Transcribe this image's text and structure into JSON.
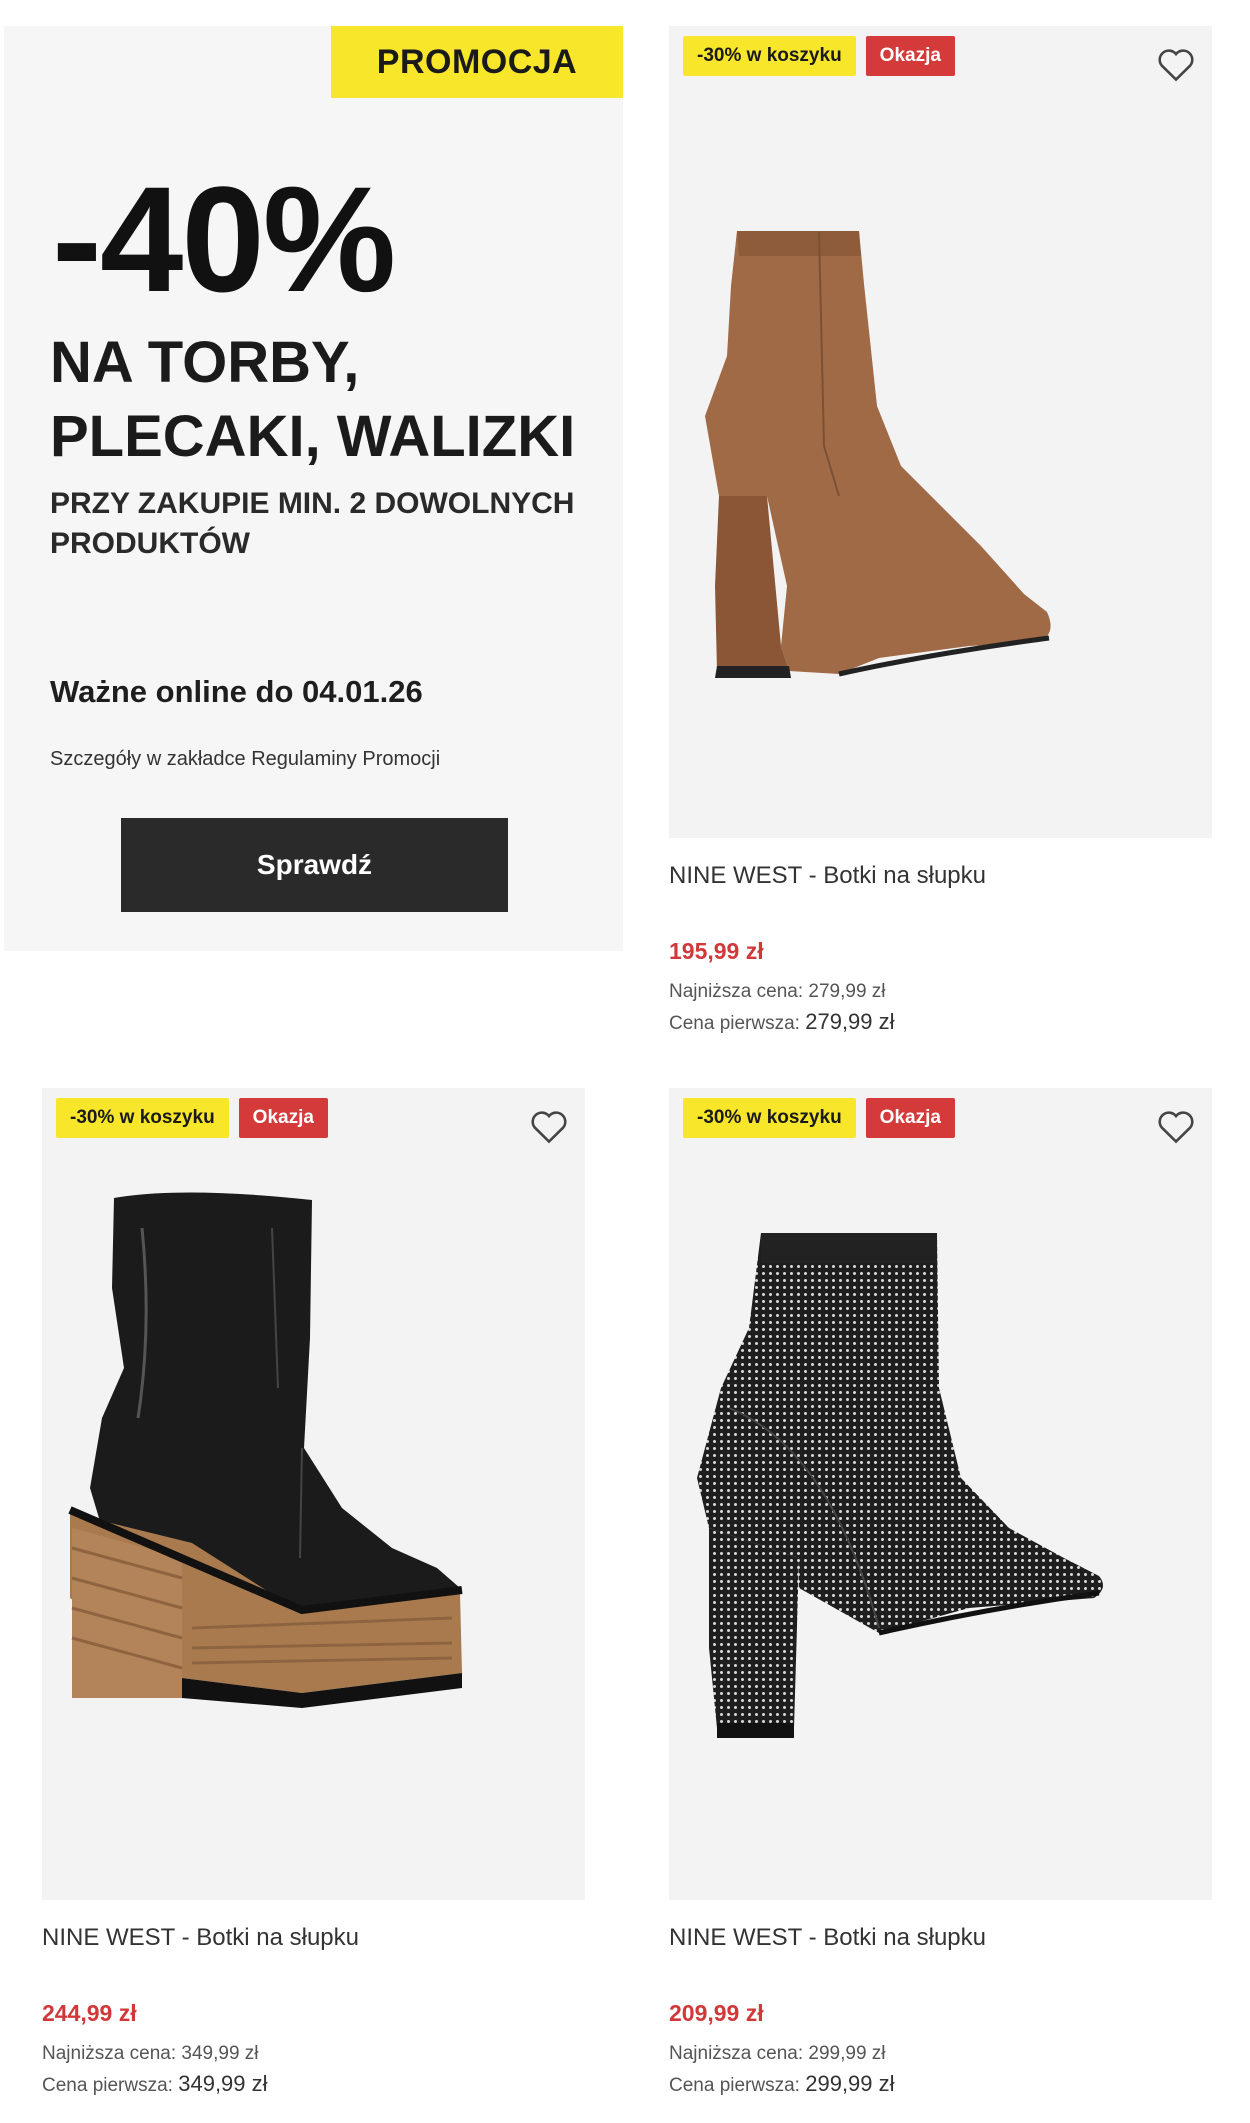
{
  "promo": {
    "tag": "PROMOCJA",
    "discount": "-40%",
    "headline": "NA TORBY, PLECAKI, WALIZKI",
    "subline": "PRZY ZAKUPIE MIN. 2 DOWOLNYCH PRODUKTÓW",
    "valid": "Ważne online do 04.01.26",
    "details": "Szczegóły w zakładce Regulaminy Promocji",
    "button": "Sprawdź"
  },
  "colors": {
    "tag_yellow": "#f7e629",
    "deal_red": "#d43a3a",
    "price_red": "#d0383a",
    "button_dark": "#2a2a2a"
  },
  "products": [
    {
      "badge_cart": "-30% w koszyku",
      "badge_deal": "Okazja",
      "icon": "heart-icon",
      "name": "NINE WEST - Botki na słupku",
      "price": "195,99 zł",
      "lowest_label": "Najniższa cena:",
      "lowest_value": "279,99 zł",
      "first_label": "Cena pierwsza:",
      "first_value": "279,99 zł",
      "image": "brown suede ankle boot with flared heel"
    },
    {
      "badge_cart": "-30% w koszyku",
      "badge_deal": "Okazja",
      "icon": "heart-icon",
      "name": "NINE WEST - Botki na słupku",
      "price": "244,99 zł",
      "lowest_label": "Najniższa cena:",
      "lowest_value": "349,99 zł",
      "first_label": "Cena pierwsza:",
      "first_value": "349,99 zł",
      "image": "black patent platform boot with wooden heel"
    },
    {
      "badge_cart": "-30% w koszyku",
      "badge_deal": "Okazja",
      "icon": "heart-icon",
      "name": "NINE WEST - Botki na słupku",
      "price": "209,99 zł",
      "lowest_label": "Najniższa cena:",
      "lowest_value": "299,99 zł",
      "first_label": "Cena pierwsza:",
      "first_value": "299,99 zł",
      "image": "black sparkly sock boot with block heel"
    }
  ]
}
